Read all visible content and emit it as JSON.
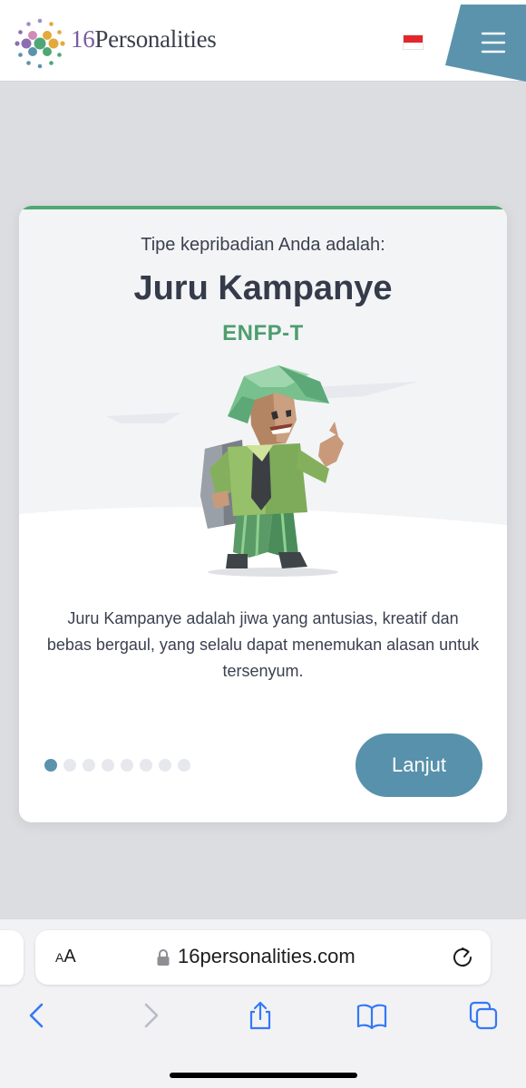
{
  "header": {
    "logo_number": "16",
    "logo_word": "Personalities",
    "flag": "indonesia-flag-icon",
    "menu": "hamburger-menu-icon",
    "menu_color": "#5b93ad"
  },
  "card": {
    "subtitle": "Tipe kepribadian Anda adalah:",
    "type_name": "Juru Kampanye",
    "type_code": "ENFP-T",
    "description": "Juru Kampanye adalah jiwa yang antusias, kreatif dan bebas bergaul, yang selalu dapat menemukan alasan untuk tersenyum.",
    "pagination": {
      "total": 8,
      "active": 1
    },
    "next_label": "Lanjut",
    "accent": "#4fa775",
    "button_color": "#5891ab"
  },
  "browser": {
    "text_size_label_small": "A",
    "text_size_label_large": "A",
    "url": "16personalities.com",
    "icons": [
      "lock-icon",
      "reload-icon",
      "back-icon",
      "forward-icon",
      "share-icon",
      "bookmarks-icon",
      "tabs-icon"
    ]
  }
}
